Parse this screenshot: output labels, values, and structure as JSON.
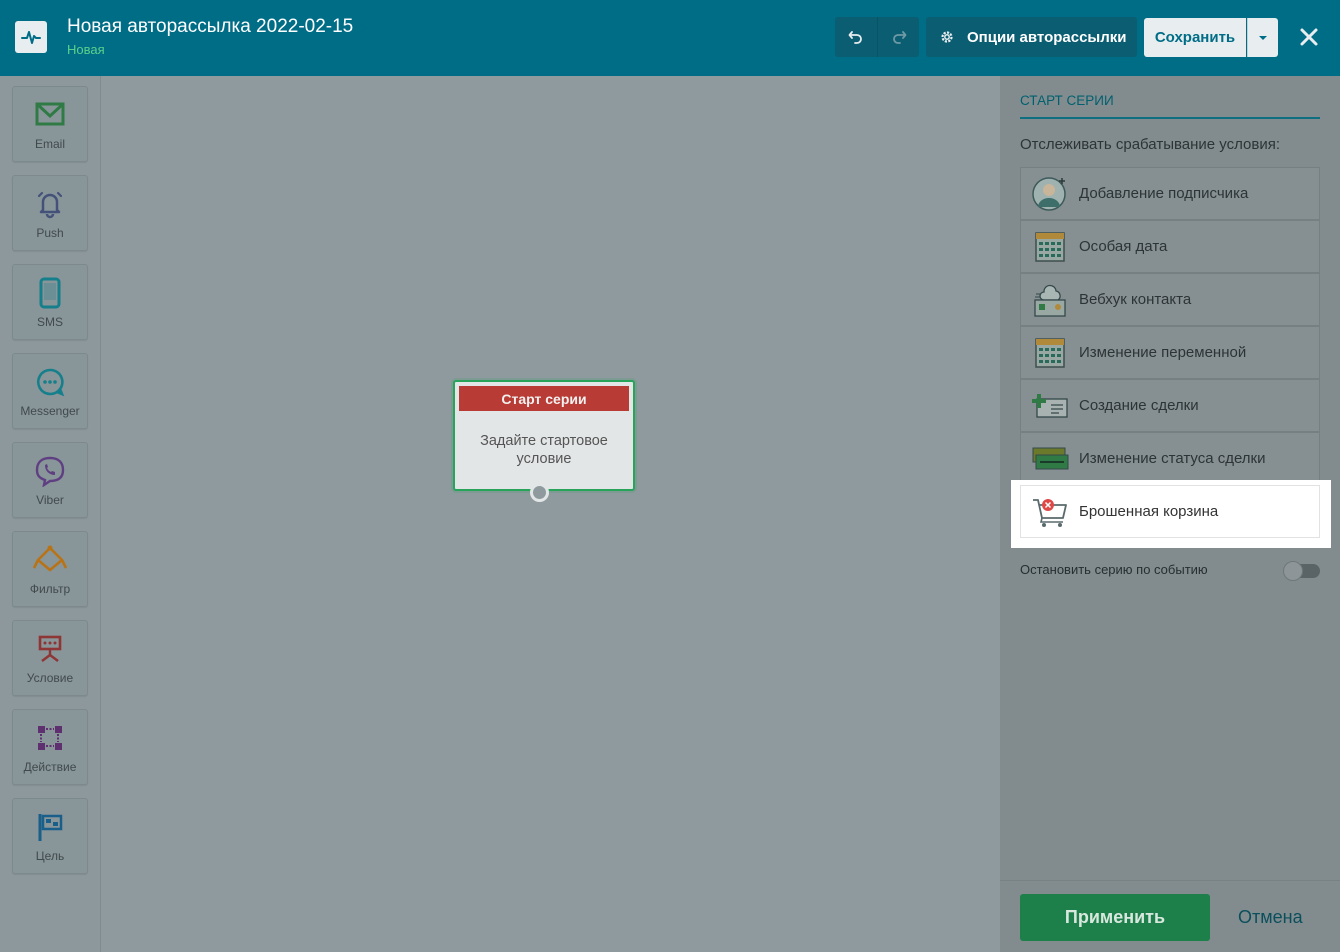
{
  "header": {
    "title": "Новая авторассылка 2022-02-15",
    "status": "Новая",
    "options_label": "Опции авторассылки",
    "save_label": "Сохранить"
  },
  "toolbar": {
    "items": [
      {
        "label": "Email",
        "icon": "envelope-icon",
        "color": "#2f8a4b"
      },
      {
        "label": "Push",
        "icon": "bell-icon",
        "color": "#4a5a7a"
      },
      {
        "label": "SMS",
        "icon": "phone-icon",
        "color": "#1a8a9a"
      },
      {
        "label": "Messenger",
        "icon": "chat-icon",
        "color": "#1a8a9a"
      },
      {
        "label": "Viber",
        "icon": "viber-icon",
        "color": "#6a4a8a"
      },
      {
        "label": "Фильтр",
        "icon": "filter-icon",
        "color": "#c27a1a"
      },
      {
        "label": "Условие",
        "icon": "condition-icon",
        "color": "#9a3a3a"
      },
      {
        "label": "Действие",
        "icon": "action-icon",
        "color": "#6a3a7a"
      },
      {
        "label": "Цель",
        "icon": "flag-icon",
        "color": "#1a6a9a"
      }
    ]
  },
  "canvas": {
    "node": {
      "title": "Старт серии",
      "body": "Задайте стартовое условие"
    }
  },
  "panel": {
    "title": "СТАРТ СЕРИИ",
    "description": "Отслеживать срабатывание условия:",
    "triggers": [
      {
        "label": "Добавление подписчика",
        "icon": "add-subscriber-icon"
      },
      {
        "label": "Особая дата",
        "icon": "calendar-icon"
      },
      {
        "label": "Вебхук контакта",
        "icon": "webhook-icon"
      },
      {
        "label": "Изменение переменной",
        "icon": "calendar-variable-icon"
      },
      {
        "label": "Создание сделки",
        "icon": "create-deal-icon"
      },
      {
        "label": "Изменение статуса сделки",
        "icon": "deal-status-icon"
      },
      {
        "label": "Брошенная корзина",
        "icon": "abandoned-cart-icon",
        "active": true
      }
    ],
    "stop_label": "Остановить серию по событию",
    "apply_label": "Применить",
    "cancel_label": "Отмена"
  },
  "colors": {
    "header_bg": "#006d87",
    "status_green": "#5cd08a",
    "node_head": "#b83b35",
    "apply_green": "#1d7f4a"
  }
}
